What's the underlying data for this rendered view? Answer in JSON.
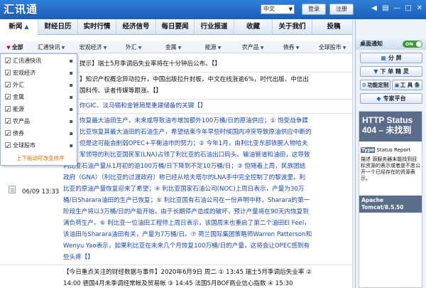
{
  "app": {
    "logo": "汇讯通"
  },
  "titlebar": {
    "language": "中文",
    "login": "登录",
    "register": "注册"
  },
  "nav": {
    "tabs": [
      "新闻",
      "财经日历",
      "实时行情",
      "经济信号",
      "每日要闻",
      "行业报道",
      "收藏",
      "关于我们",
      "投稿"
    ]
  },
  "subnav": {
    "tabs": [
      "全部",
      "汇通快讯",
      "宏观经济",
      "外汇",
      "金属",
      "能源",
      "农产品",
      "债券",
      "全球股市"
    ]
  },
  "dropdown": {
    "items": [
      "汇讯通快讯",
      "宏观经济",
      "外汇",
      "金属",
      "能源",
      "农产品",
      "债券",
      "全球股市"
    ],
    "footer": "上下拖动可改变排序"
  },
  "content": {
    "lines": [
      "提示】瑞士5月季调后失业率将在十分钟后公布。【】",
      "】知识产权概念异动拉升，中国出版拉升封板，中文在线涨逾6%，时代出版、中信出",
      "国科传、读者传媒等跟涨。【】",
      "你GIC、淡马锡和金管局是重建储备的关键【】",
      "恢复最大油田生产，未来或导致油市增加额外100万桶/日的原油供应；① 饱受战争蹂",
      "比亚恢复其最大油田的石油生产，希望结束今年早些时候国内冲突导致原油供应中断的",
      "但是这可能会削弱OPEC+平衡油市的努力；② 今年1月，由利比亚东部铁腕人物哈夫",
      "军领导的利比亚国民军(LNA)占领了利比亚的石油出口码头、输油管道和油田，这导致",
      "利比亚石油产量从1月初的逾100万桶/日下降到不足10万桶/日；③ 但随着上周，民族团结",
      "政府（GNA）（利比亚的过渡政府）称已经从哈夫塔尔的LNA手中完全控制了的黎波里。利",
      "比亚的原油产量恢复迎来了希望；④ 利比亚国家石油公司(NOC)上周日表示，产量为30万",
      "桶/日Sharara油田的生产已恢复；⑤ 利比亚国有石油公司在一份声明中称，Sharara的第一",
      "阶段生产将以3万桶/日的产能开始，由于长期停产造成的破坏，预计产量将在90天内恢复到",
      "满负荷生产。⑥ 利比亚一位油田工程师上周日表示，该国周末也重启了第二个油田El Feel，",
      "该油田与Sharara油田有关，产量为7万桶/日。⑦ 荷兰国际集团策略师Warren Patterson和",
      "Wenyu Yao表示，如果利比亚在未来几个月恢复100万桶/日的产量，这将会让OPEC感到有",
      "些头疼【】",
      "【今日重点关注的财经数据与事件】2020年6月9日 周二 ① 13:45 瑞士5月季调后失业率 ②",
      "14:00 德国4月未季调经常帐及贸易帐 ③ 14:45 法国5月BOF商业信心指数 ④ 15:30"
    ],
    "date": "06/09 13:33"
  },
  "rightpanel": {
    "notify_title": "桌面通知",
    "toggle": "ON",
    "btn_split": "分 屏",
    "btn_download": "下 单 精 灵",
    "btn_custom": "功能定制",
    "btn_tools": "工 具 条",
    "btn_expert": "专家平台"
  },
  "ad": {
    "title": "HTTP Status 404 – 未找到",
    "type_label": "Type",
    "type_value": "Status Report",
    "desc": "描述 源服务器未能找到目标资源的表示或者是不愿公开一个已经存在的资源表示。",
    "footer": "Apache Tomcat/8.5.50"
  }
}
